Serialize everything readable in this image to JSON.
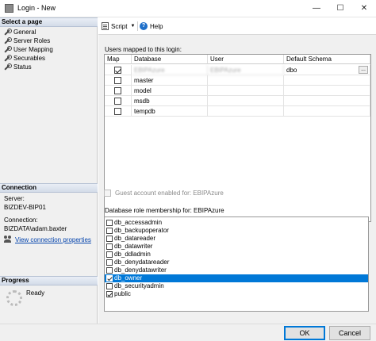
{
  "window": {
    "title": "Login - New",
    "minimize": "—",
    "maximize": "☐",
    "close": "✕"
  },
  "left_panel": {
    "select_page_header": "Select a page",
    "pages": [
      "General",
      "Server Roles",
      "User Mapping",
      "Securables",
      "Status"
    ],
    "connection_header": "Connection",
    "server_label": "Server:",
    "server_value": "BIZDEV-BIP01",
    "connection_label": "Connection:",
    "connection_value": "BIZDATA\\adam.baxter",
    "view_connection_link": "View connection properties",
    "progress_header": "Progress",
    "progress_status": "Ready"
  },
  "toolbar": {
    "script_label": "Script",
    "help_label": "Help"
  },
  "users_mapped": {
    "label": "Users mapped to this login:",
    "columns": [
      "Map",
      "Database",
      "User",
      "Default Schema"
    ],
    "rows": [
      {
        "map": true,
        "database": "EBIPAzure",
        "user": "EBIPAzure",
        "schema": "dbo"
      },
      {
        "map": false,
        "database": "master",
        "user": "",
        "schema": ""
      },
      {
        "map": false,
        "database": "model",
        "user": "",
        "schema": ""
      },
      {
        "map": false,
        "database": "msdb",
        "user": "",
        "schema": ""
      },
      {
        "map": false,
        "database": "tempdb",
        "user": "",
        "schema": ""
      }
    ],
    "schema_button": "..."
  },
  "guest": {
    "label": "Guest account enabled for: EBIPAzure",
    "enabled": false
  },
  "roles": {
    "label": "Database role membership for: EBIPAzure",
    "items": [
      {
        "name": "db_accessadmin",
        "checked": false
      },
      {
        "name": "db_backupoperator",
        "checked": false
      },
      {
        "name": "db_datareader",
        "checked": false
      },
      {
        "name": "db_datawriter",
        "checked": false
      },
      {
        "name": "db_ddladmin",
        "checked": false
      },
      {
        "name": "db_denydatareader",
        "checked": false
      },
      {
        "name": "db_denydatawriter",
        "checked": false
      },
      {
        "name": "db_owner",
        "checked": true,
        "selected": true
      },
      {
        "name": "db_securityadmin",
        "checked": false
      },
      {
        "name": "public",
        "checked": true
      }
    ]
  },
  "footer": {
    "ok_label": "OK",
    "cancel_label": "Cancel"
  }
}
